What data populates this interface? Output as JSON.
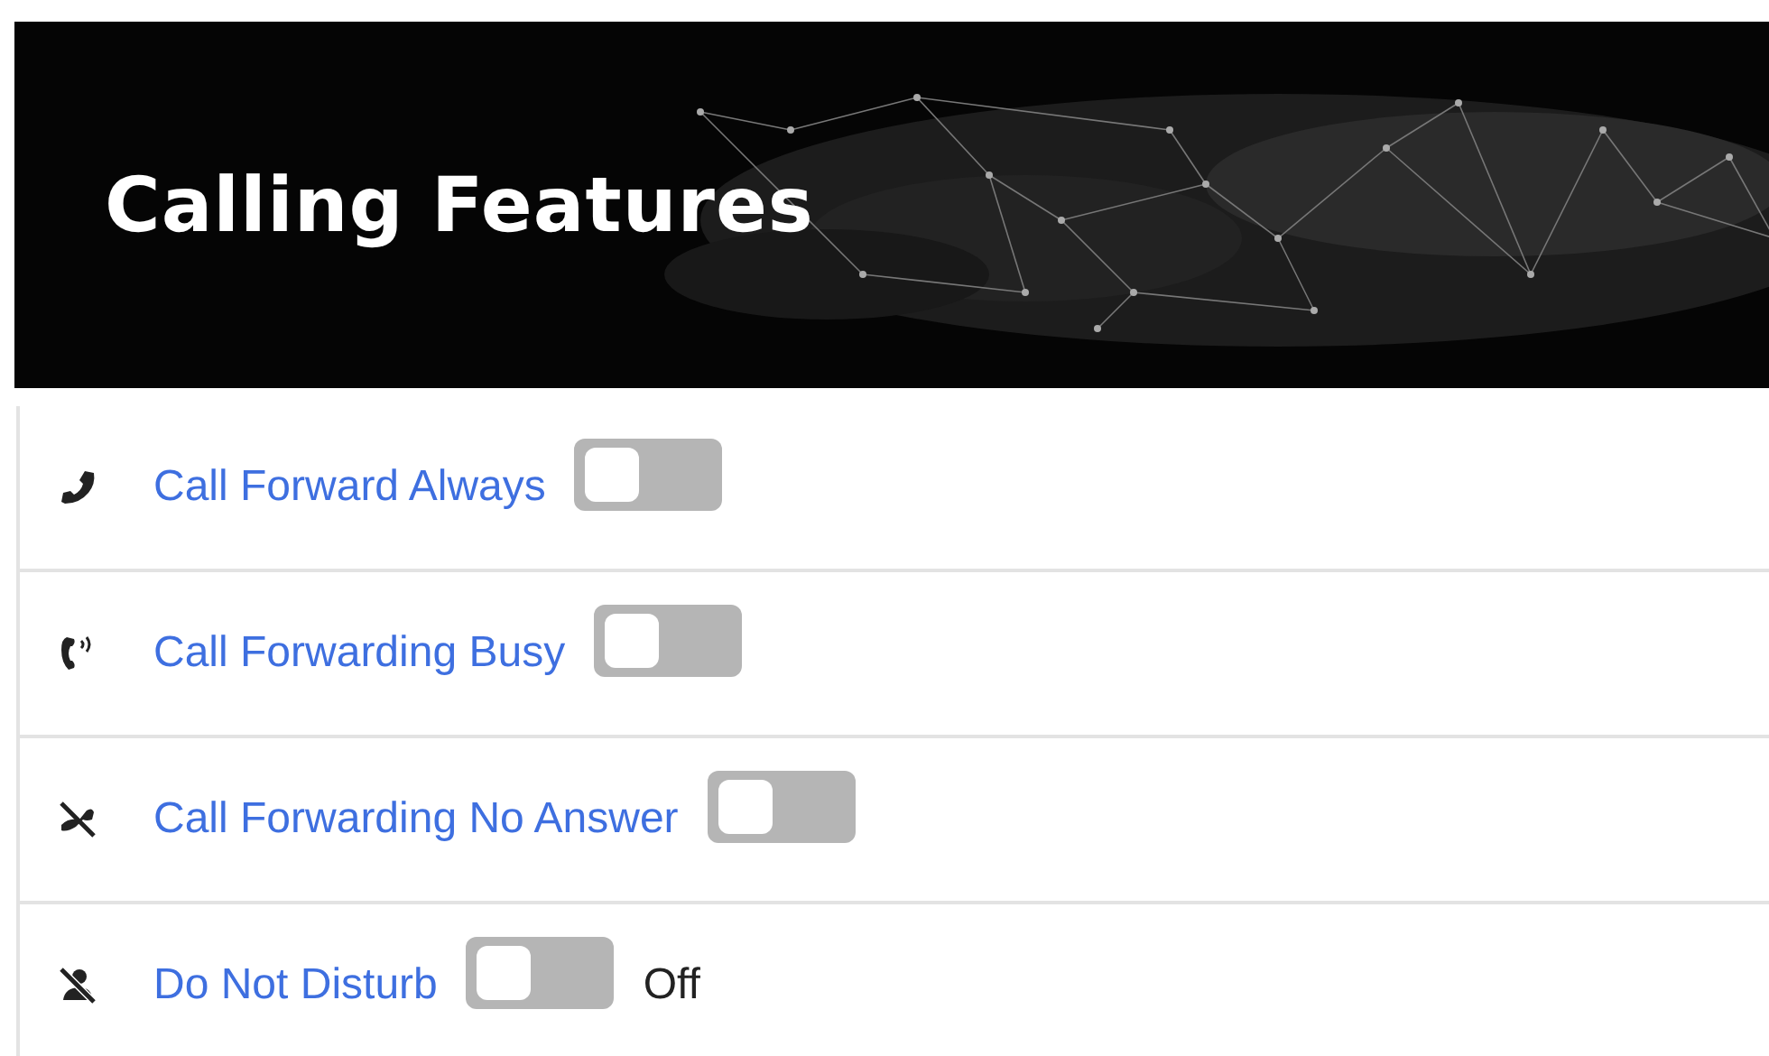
{
  "header": {
    "title": "Calling Features"
  },
  "features": [
    {
      "kind": "phone",
      "label": "Call Forward Always",
      "on": false
    },
    {
      "kind": "phone-ring",
      "label": "Call Forwarding Busy",
      "on": false
    },
    {
      "kind": "phone-slash",
      "label": "Call Forwarding No Answer",
      "on": false
    },
    {
      "kind": "person-slash",
      "label": "Do Not Disturb",
      "on": false,
      "status": "Off"
    }
  ]
}
